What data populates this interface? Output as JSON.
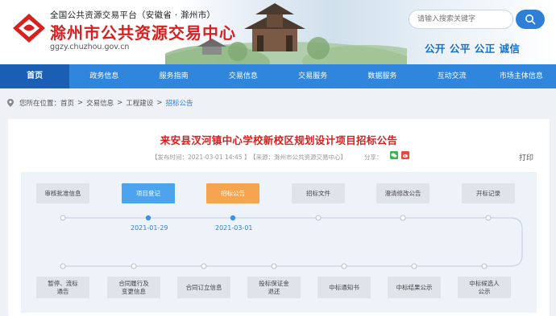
{
  "header": {
    "org_line": "全国公共资源交易平台（安徽省 · 滁州市）",
    "title": "滁州市公共资源交易中心",
    "url": "ggzy.chuzhou.gov.cn",
    "search_placeholder": "请输入搜索关键字",
    "motto": "公开 公平 公正 诚信"
  },
  "nav": {
    "items": [
      "首页",
      "政务信息",
      "服务指南",
      "交易信息",
      "交易服务",
      "数据服务",
      "互动交流",
      "市场主体信息"
    ],
    "active_index": 0
  },
  "breadcrumb": {
    "prefix": "您所在位置：",
    "items": [
      "首页",
      "交易信息",
      "工程建设",
      "招标公告"
    ],
    "separator": ">"
  },
  "article": {
    "title": "来安县汊河镇中心学校新校区规划设计项目招标公告",
    "publish_time": "【发布时间：2021-03-01 14:45 】",
    "source": "【来源：滁州市公共资源交易中心】",
    "share_label": "分享：",
    "print_label": "打印"
  },
  "process": {
    "top_steps": [
      {
        "label": "审核批准信息",
        "state": "default"
      },
      {
        "label": "项目登记",
        "state": "done"
      },
      {
        "label": "招标公告",
        "state": "current"
      },
      {
        "label": "招标文件",
        "state": "default"
      },
      {
        "label": "澄清修改公告",
        "state": "default"
      },
      {
        "label": "开标记录",
        "state": "default"
      }
    ],
    "dates": [
      "2021-01-29",
      "2021-03-01"
    ],
    "bottom_steps": [
      {
        "label": "暂停、流标\n通告"
      },
      {
        "label": "合同履行及\n变更信息"
      },
      {
        "label": "合同订立信息"
      },
      {
        "label": "投标保证金\n退还"
      },
      {
        "label": "中标通知书"
      },
      {
        "label": "中标结果公示"
      },
      {
        "label": "中标候选人\n公示"
      }
    ]
  },
  "colors": {
    "nav_bg": "#2f86dc",
    "nav_active": "#1a5fb4",
    "title_red": "#d8201f",
    "accent_blue": "#2f7fd7",
    "step_blue": "#4da3ec",
    "step_orange": "#f5a450"
  }
}
